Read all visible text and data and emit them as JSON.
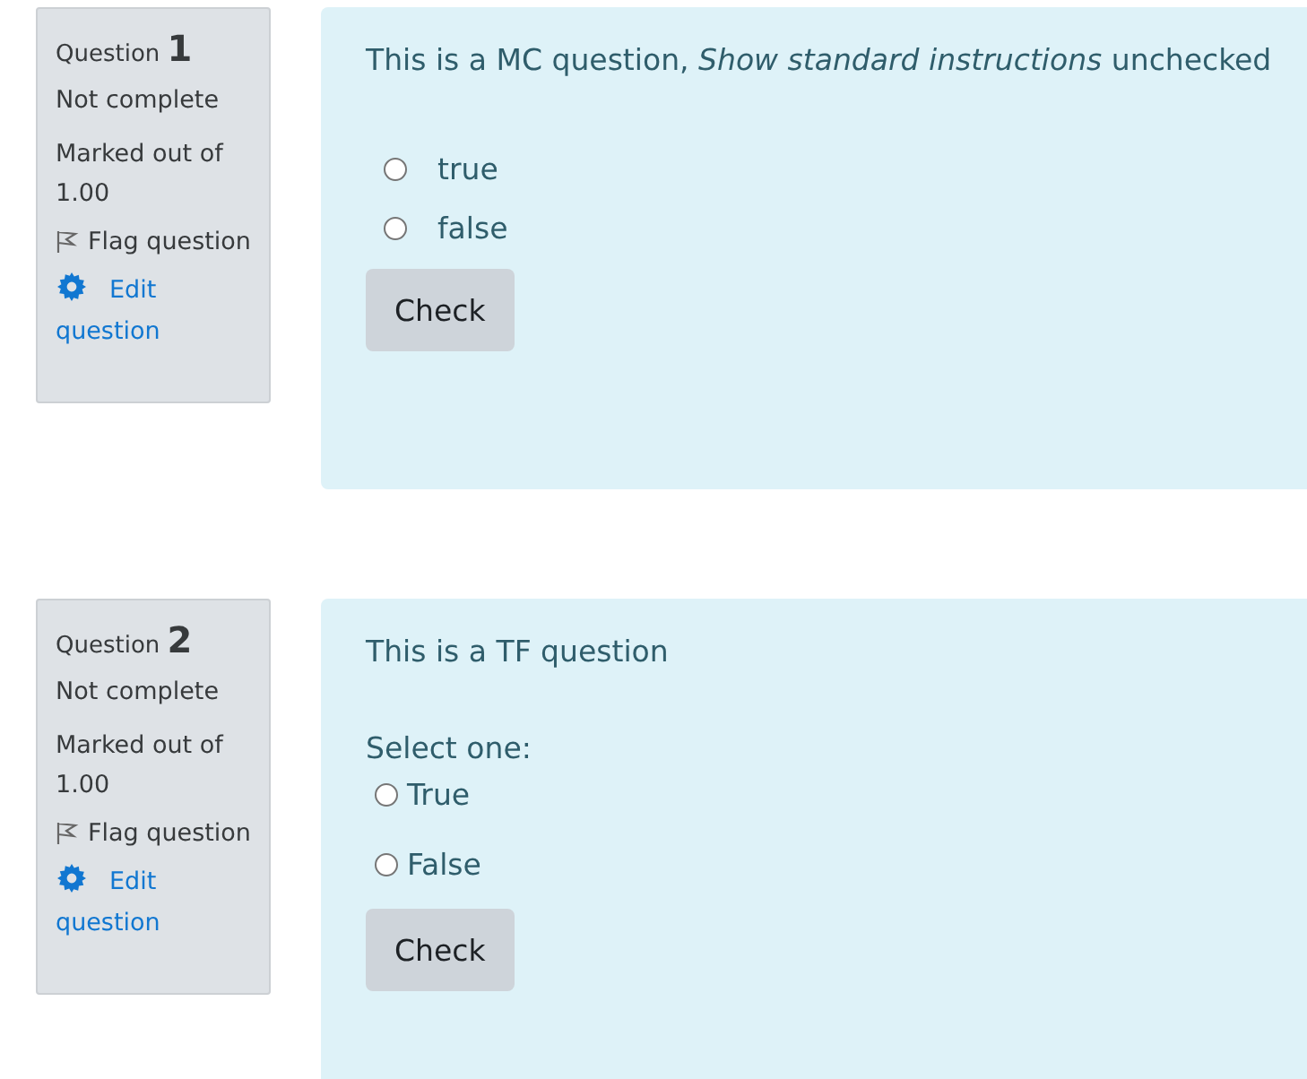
{
  "questions": [
    {
      "kind": "mc",
      "label": "Question",
      "number": "1",
      "status": "Not complete",
      "marked": "Marked out of",
      "mark": "1.00",
      "flag": "Flag question",
      "edit": "Edit",
      "edit2": "question",
      "text": "This is a MC question, *Show standard instructions* unchecked",
      "options": [
        {
          "label": "true",
          "selected": false
        },
        {
          "label": "false",
          "selected": false
        }
      ],
      "button": "Check"
    },
    {
      "kind": "tf",
      "label": "Question",
      "number": "2",
      "status": "Not complete",
      "marked": "Marked out of",
      "mark": "1.00",
      "flag": "Flag question",
      "edit": "Edit",
      "edit2": "question",
      "text": "This is a TF question",
      "prompt": "Select one:",
      "options": [
        {
          "label": "True",
          "selected": false
        },
        {
          "label": "False",
          "selected": false
        }
      ],
      "button": "Check"
    }
  ]
}
